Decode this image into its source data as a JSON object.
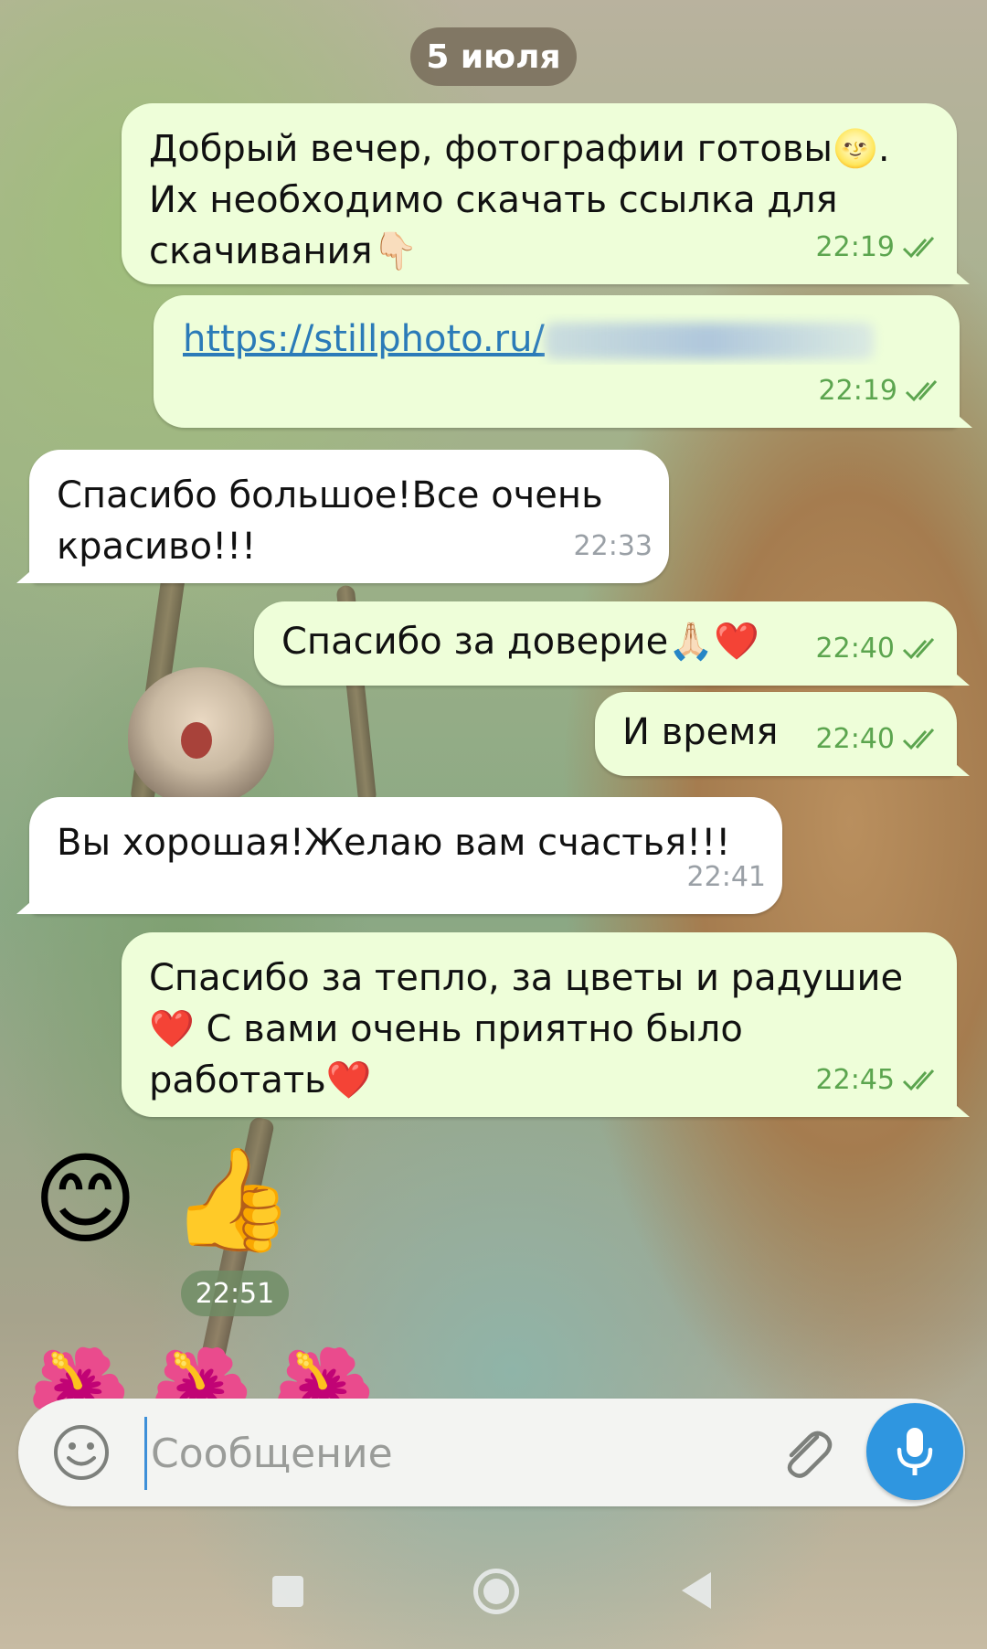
{
  "chat": {
    "date_separator": "5 июля",
    "messages": [
      {
        "direction": "out",
        "text": "Добрый вечер, фотографии готовы🌝.\nИх необходимо скачать ссылка для\nскачивания👇🏻",
        "time": "22:19",
        "status": "read"
      },
      {
        "direction": "out",
        "link": "https://stillphoto.ru/",
        "time": "22:19",
        "status": "read"
      },
      {
        "direction": "in",
        "text": "Спасибо большое!Все очень\nкрасиво!!!",
        "time": "22:33"
      },
      {
        "direction": "out",
        "text": "Спасибо за доверие🙏🏻❤️",
        "time": "22:40",
        "status": "read"
      },
      {
        "direction": "out",
        "text": "И время",
        "time": "22:40",
        "status": "read"
      },
      {
        "direction": "in",
        "text": "Вы хорошая!Желаю вам счастья!!!",
        "time": "22:41"
      },
      {
        "direction": "out",
        "text": "Спасибо за тепло, за цветы и радушие\n❤️ С вами очень приятно было\nработать❤️",
        "time": "22:45",
        "status": "read"
      },
      {
        "direction": "in",
        "emoji": "😊 👍",
        "time": "22:51"
      },
      {
        "direction": "in",
        "emoji": "🌺🌺🌺"
      }
    ]
  },
  "composer": {
    "placeholder": "Сообщение",
    "emoji_icon": "smile-icon",
    "attach_icon": "paperclip-icon",
    "mic_icon": "microphone-icon"
  },
  "colors": {
    "outgoing_bubble": "#eefed9",
    "incoming_bubble": "#ffffff",
    "outgoing_time": "#5ca54f",
    "incoming_time": "#9aa0a6",
    "link": "#2b7bb8",
    "accent": "#2f96e0"
  }
}
